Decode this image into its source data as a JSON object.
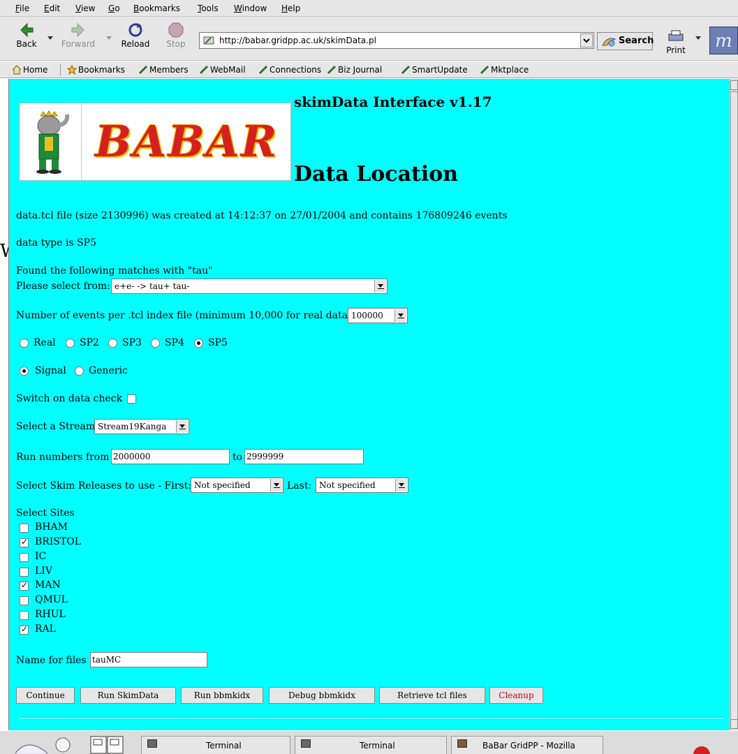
{
  "browser": {
    "menu": [
      "File",
      "Edit",
      "View",
      "Go",
      "Bookmarks",
      "Tools",
      "Window",
      "Help"
    ],
    "nav": {
      "back": "Back",
      "forward": "Forward",
      "reload": "Reload",
      "stop": "Stop",
      "print": "Print",
      "search": "Search"
    },
    "url": "http://babar.gridpp.ac.uk/skimData.pl",
    "bookmarks": [
      "Home",
      "Bookmarks",
      "Members",
      "WebMail",
      "Connections",
      "Biz Journal",
      "SmartUpdate",
      "Mktplace"
    ]
  },
  "page": {
    "logo_text": "BABAR",
    "title": "skimData Interface v1.17",
    "heading": "Data Location",
    "file_info": "data.tcl file (size 2130996) was created at 14:12:37 on 27/01/2004 and contains 176809246 events",
    "data_type": "data type is SP5",
    "stray_letter": "W",
    "matches_text": "Found the following matches with \"tau\"",
    "select_label": "Please select from:",
    "select_value": "e+e- -> tau+ tau-",
    "events_label": "Number of events per .tcl index file (minimum 10,000 for real data)",
    "events_value": "100000",
    "data_kinds": [
      {
        "label": "Real",
        "selected": false
      },
      {
        "label": "SP2",
        "selected": false
      },
      {
        "label": "SP3",
        "selected": false
      },
      {
        "label": "SP4",
        "selected": false
      },
      {
        "label": "SP5",
        "selected": true
      }
    ],
    "mc_kinds": [
      {
        "label": "Signal",
        "selected": true
      },
      {
        "label": "Generic",
        "selected": false
      }
    ],
    "data_check_label": "Switch on data check",
    "data_check": false,
    "stream_label": "Select a Stream",
    "stream_value": "Stream19Kanga",
    "run_from_label": "Run numbers from",
    "run_from": "2000000",
    "run_to_label": "to",
    "run_to": "2999999",
    "skim_label": "Select Skim Releases to use - First:",
    "skim_first": "Not specified",
    "skim_last_label": "Last:",
    "skim_last": "Not specified",
    "sites_label": "Select Sites",
    "sites": [
      {
        "name": "BHAM",
        "checked": false
      },
      {
        "name": "BRISTOL",
        "checked": true
      },
      {
        "name": "IC",
        "checked": false
      },
      {
        "name": "LIV",
        "checked": false
      },
      {
        "name": "MAN",
        "checked": true
      },
      {
        "name": "QMUL",
        "checked": false
      },
      {
        "name": "RHUL",
        "checked": false
      },
      {
        "name": "RAL",
        "checked": true
      }
    ],
    "name_label": "Name for files",
    "name_value": "tauMC",
    "buttons": [
      "Continue",
      "Run SkimData",
      "Run bbmkidx",
      "Debug bbmkidx",
      "Retrieve tcl files",
      "Cleanup"
    ],
    "cleanup_color": "#cc0000",
    "background_color": "#00ffff"
  },
  "taskbar": {
    "tasks": [
      "Terminal",
      "Terminal",
      "BaBar GridPP - Mozilla"
    ]
  }
}
